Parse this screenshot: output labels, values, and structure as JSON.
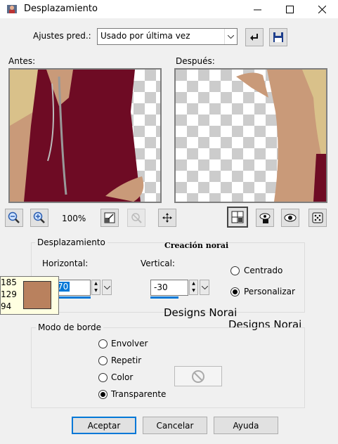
{
  "window": {
    "title": "Desplazamiento",
    "icon": "app-icon"
  },
  "presets": {
    "label": "Ajustes pred.:",
    "value": "Usado por última vez"
  },
  "before": {
    "label": "Antes:"
  },
  "after": {
    "label": "Después:"
  },
  "zoom": {
    "level": "100%"
  },
  "offset_group": {
    "legend": "Desplazamiento",
    "horizontal_label": "Horizontal:",
    "horizontal_value": "70",
    "vertical_label": "Vertical:",
    "vertical_value": "-30",
    "centered_label": "Centrado",
    "custom_label": "Personalizar",
    "selected": "custom"
  },
  "edge_group": {
    "legend": "Modo de borde",
    "options": [
      "Envolver",
      "Repetir",
      "Color",
      "Transparente"
    ],
    "selected": "Transparente"
  },
  "color_tooltip": {
    "r": "185",
    "g": "129",
    "b": "94",
    "swatch": "#b9815e"
  },
  "buttons": {
    "ok": "Aceptar",
    "cancel": "Cancelar",
    "help": "Ayuda"
  },
  "watermarks": {
    "creacion": "Creación norai",
    "designs1": "Designs Norai",
    "designs2": "Designs Norai"
  },
  "colors": {
    "accent": "#0078d7",
    "tooltip_bg": "#ffffe1"
  }
}
